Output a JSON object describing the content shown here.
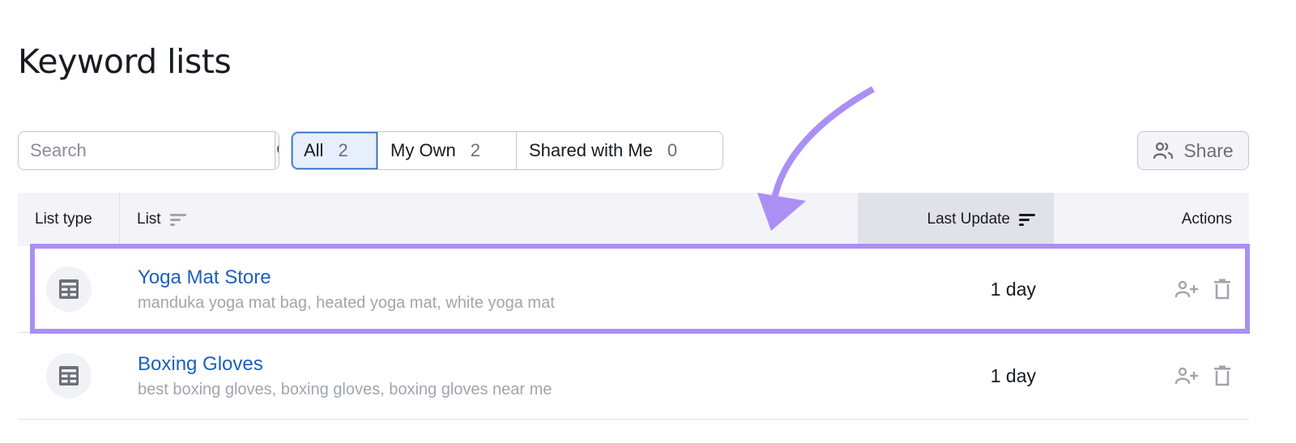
{
  "page": {
    "title": "Keyword lists"
  },
  "search": {
    "placeholder": "Search",
    "value": "",
    "icon": "search-icon"
  },
  "filters": [
    {
      "label": "All",
      "count": "2",
      "active": true
    },
    {
      "label": "My Own",
      "count": "2",
      "active": false
    },
    {
      "label": "Shared with Me",
      "count": "0",
      "active": false
    }
  ],
  "share_button": {
    "label": "Share",
    "icon": "users-icon"
  },
  "table": {
    "columns": [
      {
        "label": "List type"
      },
      {
        "label": "List",
        "icon": "sort-icon"
      },
      {
        "label": "Last Update",
        "icon": "sort-active-icon",
        "sorted": true
      },
      {
        "label": "Actions"
      }
    ],
    "rows": [
      {
        "type_icon": "table-icon",
        "name": "Yoga Mat Store",
        "keywords": "manduka yoga mat bag, heated yoga mat, white yoga mat",
        "last_update": "1 day",
        "actions": [
          "add-user-icon",
          "trash-icon"
        ],
        "highlighted": true
      },
      {
        "type_icon": "table-icon",
        "name": "Boxing Gloves",
        "keywords": "best boxing gloves, boxing gloves, boxing gloves near me",
        "last_update": "1 day",
        "actions": [
          "add-user-icon",
          "trash-icon"
        ],
        "highlighted": false
      }
    ]
  },
  "annotation": {
    "color": "#ac8ff3",
    "type": "arrow-and-highlight"
  },
  "colors": {
    "link": "#1b5fbf",
    "active_tab_bg": "#e6effb",
    "active_tab_border": "#2b6cc4",
    "header_bg": "#f4f4f8",
    "sorted_header_bg": "#e0e1e9"
  }
}
